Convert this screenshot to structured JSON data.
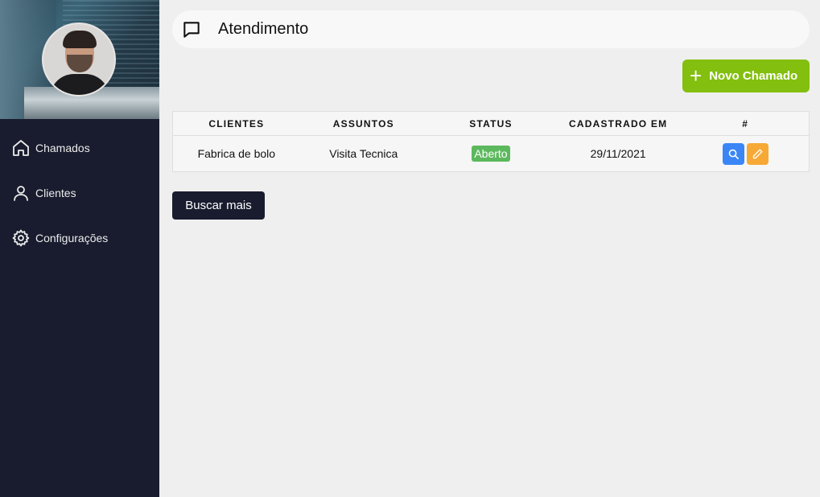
{
  "sidebar": {
    "items": [
      {
        "label": "Chamados",
        "icon": "home-icon"
      },
      {
        "label": "Clientes",
        "icon": "user-icon"
      },
      {
        "label": "Configurações",
        "icon": "gear-icon"
      }
    ]
  },
  "header": {
    "title": "Atendimento",
    "icon": "message-square-icon"
  },
  "toolbar": {
    "new_label": "Novo Chamado",
    "new_icon": "plus-icon"
  },
  "table": {
    "headers": [
      "CLIENTES",
      "ASSUNTOS",
      "STATUS",
      "CADASTRADO EM",
      "#"
    ],
    "rows": [
      {
        "cliente": "Fabrica de bolo",
        "assunto": "Visita Tecnica",
        "status": "Aberto",
        "cadastrado": "29/11/2021"
      }
    ]
  },
  "more_label": "Buscar mais",
  "colors": {
    "sidebar": "#181c2e",
    "accent_green": "#83bf0f",
    "status_open": "#5cb85c",
    "search_button": "#3a86f7",
    "edit_button": "#f6a935"
  }
}
